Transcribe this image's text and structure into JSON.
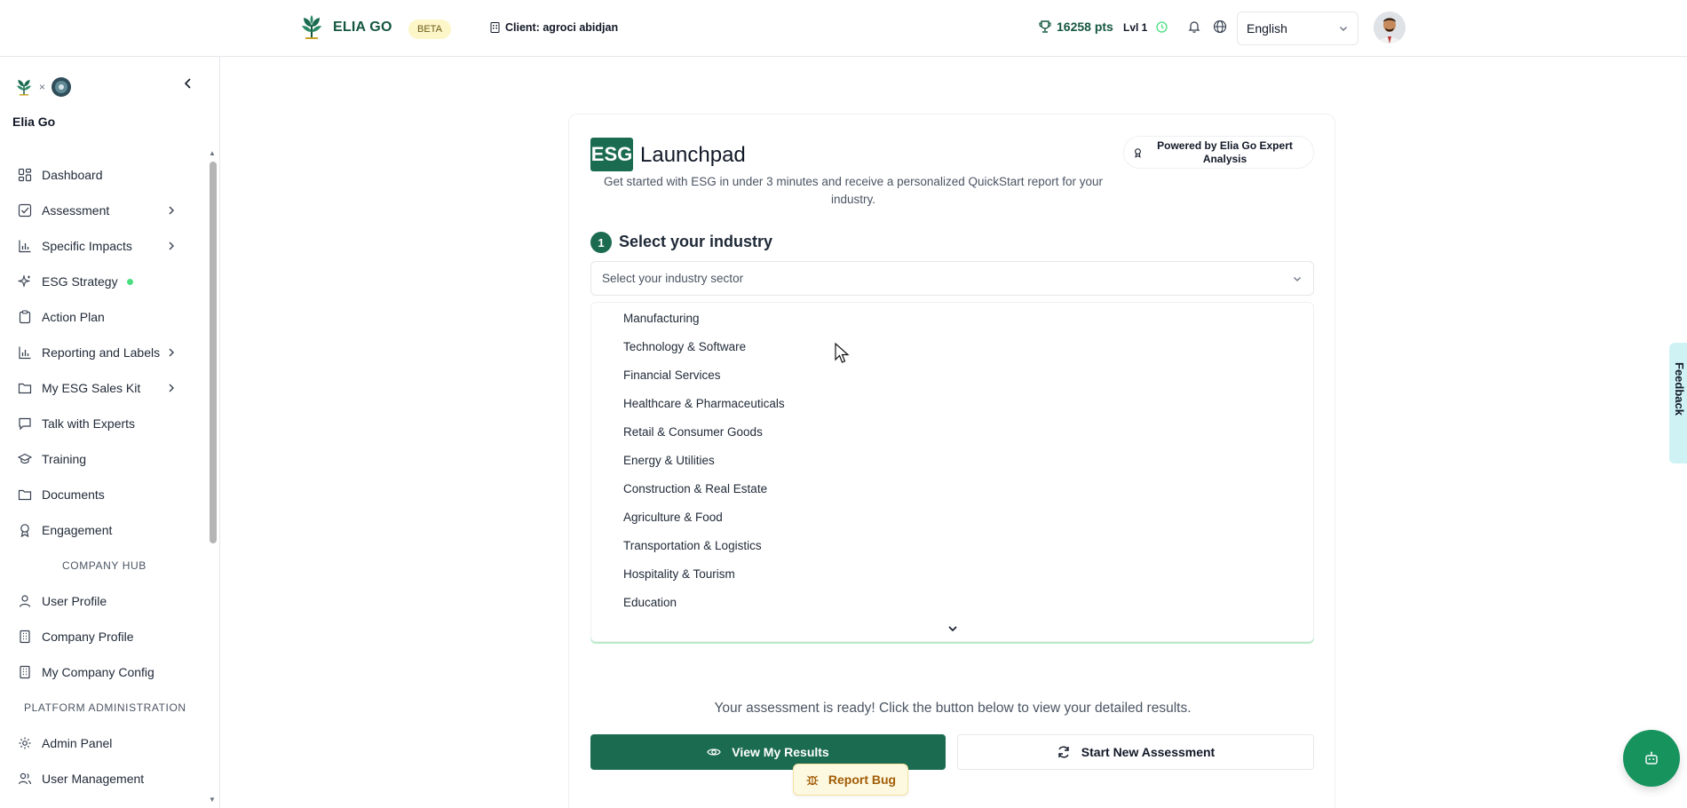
{
  "topbar": {
    "brand": "ELIA GO",
    "beta": "BETA",
    "client": "Client: agroci abidjan",
    "points": "16258 pts",
    "level": "Lvl 1",
    "language": "English"
  },
  "sidebar": {
    "title": "Elia Go",
    "x_sep": "×",
    "items": [
      {
        "label": "Dashboard",
        "icon": "dashboard-icon"
      },
      {
        "label": "Assessment",
        "icon": "clipboard-check-icon",
        "has_children": true
      },
      {
        "label": "Specific Impacts",
        "icon": "bar-chart-icon",
        "has_children": true
      },
      {
        "label": "ESG Strategy",
        "icon": "sparkles-icon",
        "status_dot": true
      },
      {
        "label": "Action Plan",
        "icon": "clipboard-icon"
      },
      {
        "label": "Reporting and Labels",
        "icon": "bar-chart-icon",
        "has_children": true
      },
      {
        "label": "My ESG Sales Kit",
        "icon": "folder-icon",
        "has_children": true
      },
      {
        "label": "Talk with Experts",
        "icon": "message-icon"
      },
      {
        "label": "Training",
        "icon": "graduation-cap-icon"
      },
      {
        "label": "Documents",
        "icon": "folder-icon"
      },
      {
        "label": "Engagement",
        "icon": "award-icon"
      }
    ],
    "company_hub": {
      "heading": "COMPANY HUB",
      "items": [
        {
          "label": "User Profile",
          "icon": "user-icon"
        },
        {
          "label": "Company Profile",
          "icon": "building-icon"
        },
        {
          "label": "My Company Config",
          "icon": "building-icon"
        }
      ]
    },
    "platform_admin": {
      "heading": "PLATFORM ADMINISTRATION",
      "items": [
        {
          "label": "Admin Panel",
          "icon": "gear-icon"
        },
        {
          "label": "User Management",
          "icon": "users-icon"
        }
      ]
    }
  },
  "launchpad": {
    "badge": "ESG",
    "title": "Launchpad",
    "powered_by": "Powered by Elia Go Expert Analysis",
    "subtitle": "Get started with ESG in under 3 minutes and receive a personalized QuickStart report for your industry.",
    "step_number": "1",
    "step_title": "Select your industry",
    "select_placeholder": "Select your industry sector",
    "options": [
      "Manufacturing",
      "Technology & Software",
      "Financial Services",
      "Healthcare & Pharmaceuticals",
      "Retail & Consumer Goods",
      "Energy & Utilities",
      "Construction & Real Estate",
      "Agriculture & Food",
      "Transportation & Logistics",
      "Hospitality & Tourism",
      "Education"
    ],
    "ready_text": "Your assessment is ready! Click the button below to view your detailed results.",
    "view_results": "View My Results",
    "new_assessment": "Start New Assessment"
  },
  "floating": {
    "report_bug": "Report Bug",
    "feedback": "Feedback"
  },
  "colors": {
    "brand_green": "#1b6b50",
    "accent_green": "#17935e",
    "beta_bg": "#fdf6c9",
    "report_bug_text": "#a15c07",
    "feedback_bg": "#cff3f4"
  }
}
